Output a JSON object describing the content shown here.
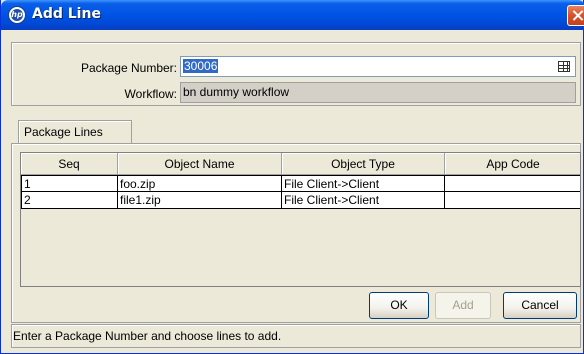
{
  "window": {
    "title": "Add Line",
    "logo_glyph": "hp",
    "close_icon": "close-icon"
  },
  "form": {
    "package_number_label": "Package Number:",
    "package_number_value": "30006",
    "workflow_label": "Workflow:",
    "workflow_value": "bn dummy workflow",
    "lookup_icon": "lookup-grid-icon"
  },
  "tabs": [
    {
      "label": "Package Lines",
      "selected": true
    }
  ],
  "table": {
    "columns": [
      "Seq",
      "Object Name",
      "Object Type",
      "App Code"
    ],
    "rows": [
      [
        "1",
        "foo.zip",
        "File Client->Client",
        ""
      ],
      [
        "2",
        "file1.zip",
        "File Client->Client",
        ""
      ]
    ]
  },
  "buttons": {
    "ok": "OK",
    "add": "Add",
    "cancel": "Cancel"
  },
  "status": "Enter a Package Number and choose lines to add.",
  "colors": {
    "title_bar": "#0055e5",
    "window_bg": "#ece9d8",
    "selection": "#316ac5",
    "close_button": "#d9512b"
  }
}
